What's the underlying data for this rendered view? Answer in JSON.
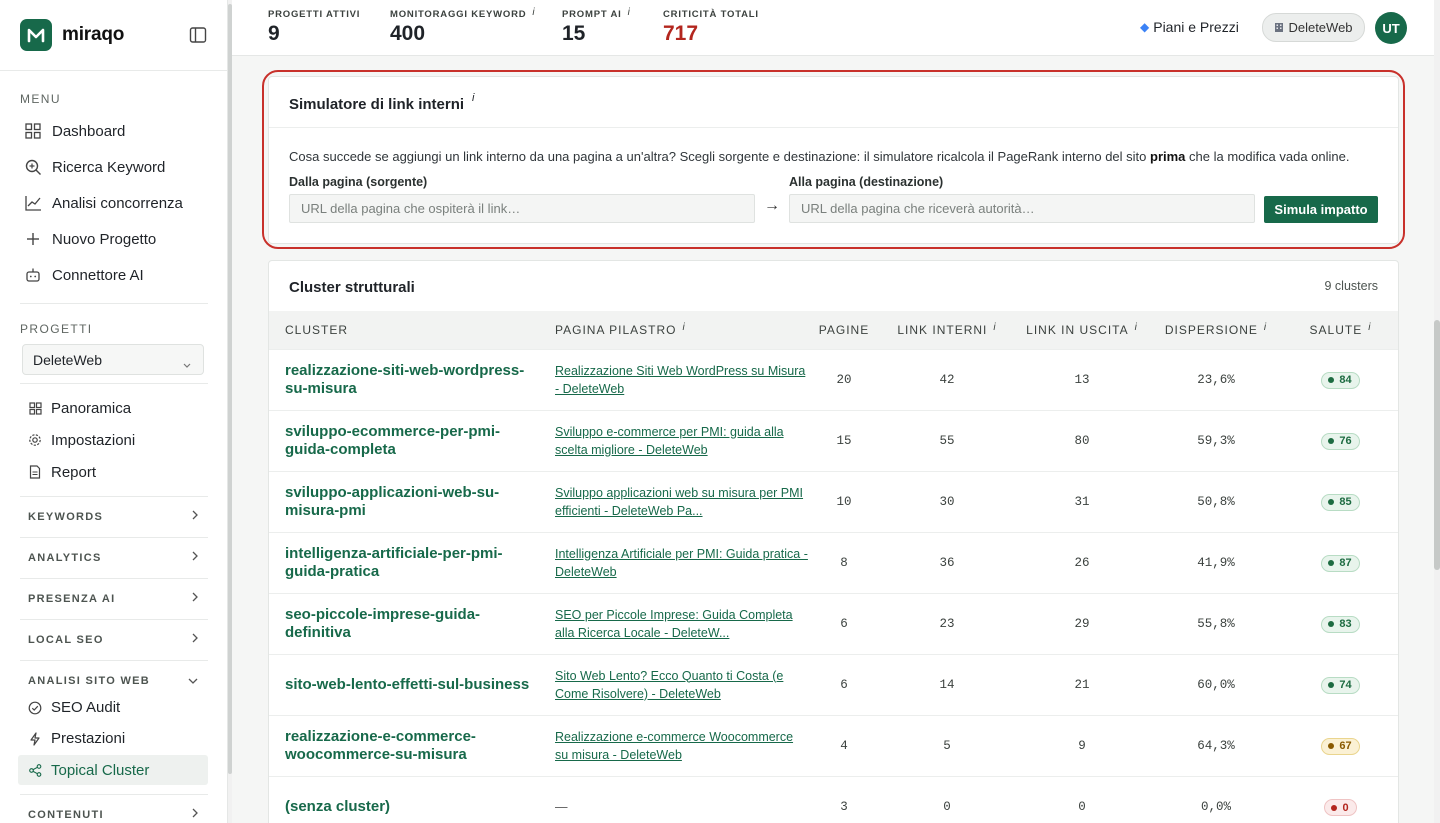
{
  "brand": {
    "name": "miraqo"
  },
  "menu": {
    "label": "MENU",
    "items": [
      {
        "label": "Dashboard",
        "icon": "grid-icon"
      },
      {
        "label": "Ricerca Keyword",
        "icon": "search-icon"
      },
      {
        "label": "Analisi concorrenza",
        "icon": "chart-line-icon"
      },
      {
        "label": "Nuovo Progetto",
        "icon": "plus-icon"
      },
      {
        "label": "Connettore AI",
        "icon": "robot-icon"
      }
    ]
  },
  "projects": {
    "label": "PROGETTI",
    "selected": "DeleteWeb",
    "items": [
      {
        "label": "Panoramica",
        "icon": "grid-small-icon"
      },
      {
        "label": "Impostazioni",
        "icon": "gear-icon"
      },
      {
        "label": "Report",
        "icon": "document-icon"
      }
    ]
  },
  "groups": {
    "keywords": "KEYWORDS",
    "analytics": "ANALYTICS",
    "presenza_ai": "PRESENZA AI",
    "local_seo": "LOCAL SEO",
    "analisi_sito": "ANALISI SITO WEB",
    "contenuti": "CONTENUTI"
  },
  "analisi_items": [
    {
      "label": "SEO Audit"
    },
    {
      "label": "Prestazioni"
    },
    {
      "label": "Topical Cluster"
    }
  ],
  "stats": [
    {
      "label": "PROGETTI ATTIVI",
      "value": "9",
      "info": ""
    },
    {
      "label": "MONITORAGGI KEYWORD",
      "value": "400",
      "info": "i"
    },
    {
      "label": "PROMPT AI",
      "value": "15",
      "info": "i"
    },
    {
      "label": "CRITICITÀ TOTALI",
      "value": "717",
      "info": ""
    }
  ],
  "topbar": {
    "plans": "Piani e Prezzi",
    "workspace": "DeleteWeb",
    "avatar": "UT"
  },
  "simulator": {
    "title": "Simulatore di link interni",
    "info": "i",
    "desc_before": "Cosa succede se aggiungi un link interno da una pagina a un'altra? Scegli sorgente e destinazione: il simulatore ricalcola il PageRank interno del sito ",
    "desc_bold": "prima",
    "desc_after": " che la modifica vada online.",
    "source_label": "Dalla pagina (sorgente)",
    "source_placeholder": "URL della pagina che ospiterà il link…",
    "dest_label": "Alla pagina (destinazione)",
    "dest_placeholder": "URL della pagina che riceverà autorità…",
    "arrow": "→",
    "button": "Simula impatto"
  },
  "clusters": {
    "title": "Cluster strutturali",
    "count": "9 clusters",
    "columns": {
      "cluster": "CLUSTER",
      "pillar": "PAGINA PILASTRO",
      "pages": "PAGINE",
      "internal": "LINK INTERNI",
      "outgoing": "LINK IN USCITA",
      "dispersion": "DISPERSIONE",
      "health": "SALUTE",
      "info": "i"
    },
    "rows": [
      {
        "name": "realizzazione-siti-web-wordpress-su-misura",
        "pillar": "Realizzazione Siti Web WordPress su Misura - DeleteWeb",
        "pages": "20",
        "internal": "42",
        "outgoing": "13",
        "dispersion": "23,6%",
        "health": "84",
        "level": "green"
      },
      {
        "name": "sviluppo-ecommerce-per-pmi-guida-completa",
        "pillar": "Sviluppo e-commerce per PMI: guida alla scelta migliore - DeleteWeb",
        "pages": "15",
        "internal": "55",
        "outgoing": "80",
        "dispersion": "59,3%",
        "health": "76",
        "level": "green"
      },
      {
        "name": "sviluppo-applicazioni-web-su-misura-pmi",
        "pillar": "Sviluppo applicazioni web su misura per PMI efficienti - DeleteWeb Pa...",
        "pages": "10",
        "internal": "30",
        "outgoing": "31",
        "dispersion": "50,8%",
        "health": "85",
        "level": "green"
      },
      {
        "name": "intelligenza-artificiale-per-pmi-guida-pratica",
        "pillar": "Intelligenza Artificiale per PMI: Guida pratica - DeleteWeb",
        "pages": "8",
        "internal": "36",
        "outgoing": "26",
        "dispersion": "41,9%",
        "health": "87",
        "level": "green"
      },
      {
        "name": "seo-piccole-imprese-guida-definitiva",
        "pillar": "SEO per Piccole Imprese: Guida Completa alla Ricerca Locale - DeleteW...",
        "pages": "6",
        "internal": "23",
        "outgoing": "29",
        "dispersion": "55,8%",
        "health": "83",
        "level": "green"
      },
      {
        "name": "sito-web-lento-effetti-sul-business",
        "pillar": "Sito Web Lento? Ecco Quanto ti Costa (e Come Risolvere) - DeleteWeb",
        "pages": "6",
        "internal": "14",
        "outgoing": "21",
        "dispersion": "60,0%",
        "health": "74",
        "level": "green"
      },
      {
        "name": "realizzazione-e-commerce-woocommerce-su-misura",
        "pillar": "Realizzazione e-commerce Woocommerce su misura - DeleteWeb",
        "pages": "4",
        "internal": "5",
        "outgoing": "9",
        "dispersion": "64,3%",
        "health": "67",
        "level": "yellow"
      },
      {
        "name": "(senza cluster)",
        "pillar": "—",
        "pages": "3",
        "internal": "0",
        "outgoing": "0",
        "dispersion": "0,0%",
        "health": "0",
        "level": "red"
      }
    ]
  }
}
